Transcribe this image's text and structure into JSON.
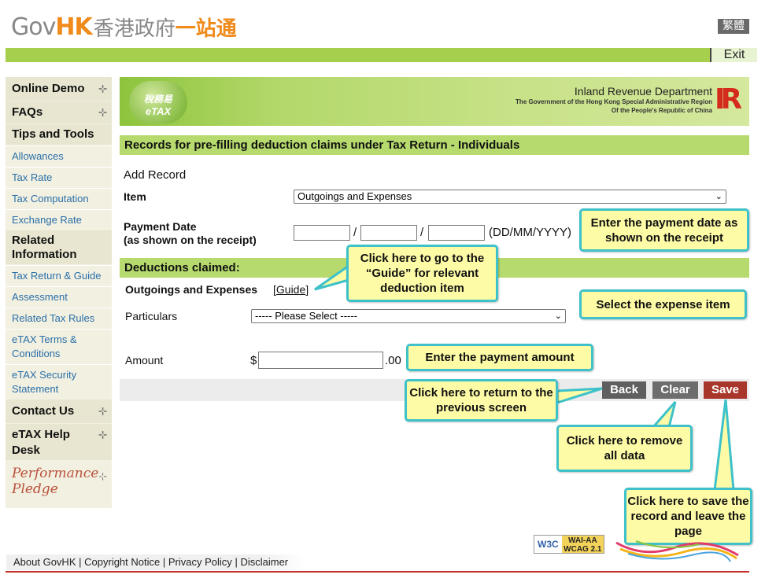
{
  "header": {
    "logo_gov": "Gov",
    "logo_hk": "HK",
    "logo_cn": "香港政府",
    "logo_cn2": "一站通",
    "lang_button": "繁體",
    "exit_button": "Exit"
  },
  "sidebar": {
    "online_demo": "Online Demo",
    "faqs": "FAQs",
    "tips_tools": "Tips and Tools",
    "allowances": "Allowances",
    "tax_rate": "Tax Rate",
    "tax_computation": "Tax Computation",
    "exchange_rate": "Exchange Rate",
    "related_info": "Related Information",
    "tax_return_guide": "Tax Return & Guide",
    "assessment": "Assessment",
    "related_tax_rules": "Related Tax Rules",
    "etax_terms": "eTAX Terms & Conditions",
    "etax_security": "eTAX Security Statement",
    "contact_us": "Contact Us",
    "etax_help": "eTAX Help Desk",
    "performance": "Performance",
    "pledge": "Pledge"
  },
  "banner": {
    "etax_cn": "稅務易",
    "etax_en": "eTAX",
    "dept": "Inland Revenue Department",
    "gov1": "The Government of the Hong Kong Special Administrative Region",
    "gov2": "Of the People's Republic of China"
  },
  "page": {
    "title": "Records for pre-filling deduction claims under Tax Return - Individuals",
    "add_record": "Add Record",
    "item_label": "Item",
    "item_value": "Outgoings and Expenses",
    "payment_date_label": "Payment Date",
    "payment_date_sub": "(as shown on the receipt)",
    "date_sep": "/",
    "date_format": "(DD/MM/YYYY)",
    "deductions_title": "Deductions claimed:",
    "outgoings_label": "Outgoings and Expenses",
    "guide_open": "[",
    "guide_link": "Guide",
    "guide_close": "]",
    "particulars_label": "Particulars",
    "particulars_value": "----- Please Select -----",
    "amount_label": "Amount",
    "currency": "$",
    "cents": ".00"
  },
  "buttons": {
    "back": "Back",
    "clear": "Clear",
    "save": "Save"
  },
  "colors": {
    "back": "#5f5f5f",
    "clear": "#6d6d6d",
    "save": "#a8362a",
    "green_bar": "#b6da6d",
    "callout_bg": "#fdfba6",
    "callout_border": "#3ec1c9"
  },
  "callouts": {
    "payment_date": "Enter the payment date as shown on the receipt",
    "guide": "Click here to go to the “Guide” for relevant deduction item",
    "expense": "Select the expense item",
    "amount": "Enter the payment amount",
    "back": "Click here to return to the previous screen",
    "clear": "Click here to remove all data",
    "save": "Click here to save the record and leave the page"
  },
  "footer": {
    "about": "About GovHK",
    "copyright": "Copyright Notice",
    "privacy": "Privacy Policy",
    "disclaimer": "Disclaimer",
    "sep": "|",
    "w3c": "W3C",
    "wai": "WAI-AA",
    "wcag": "WCAG 2.1"
  }
}
